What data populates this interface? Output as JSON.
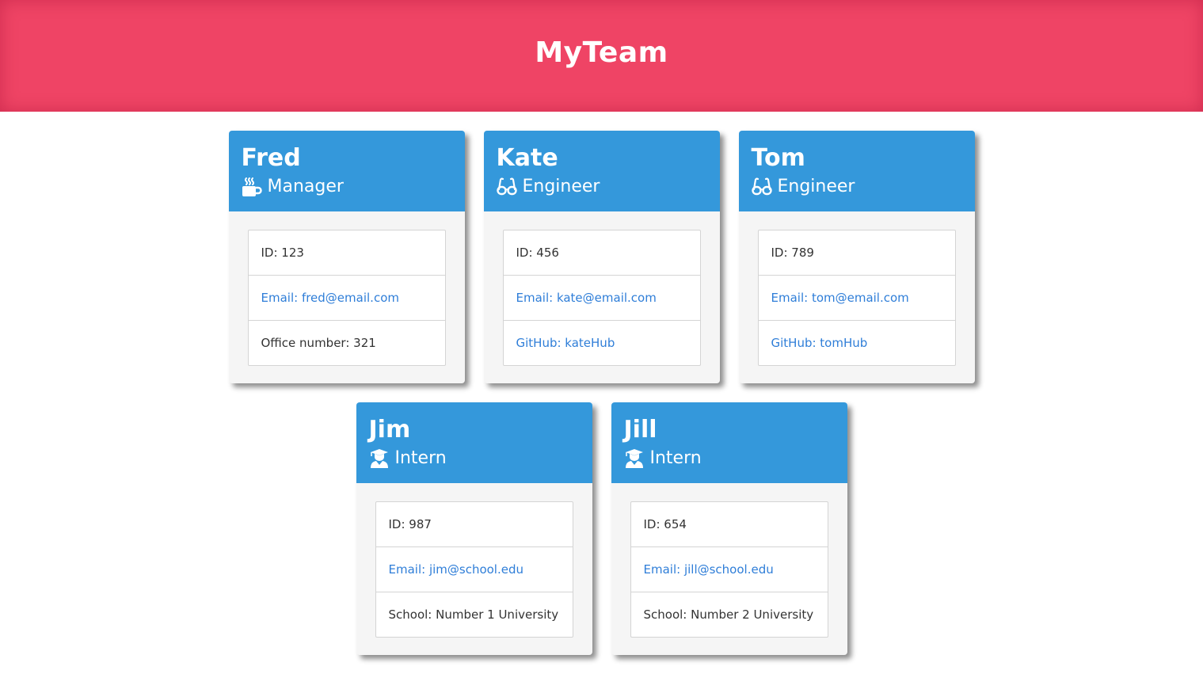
{
  "header": {
    "title": "MyTeam"
  },
  "colors": {
    "header_bg": "#ef4465",
    "card_head_bg": "#3498db",
    "link": "#2f7ed8"
  },
  "team": [
    {
      "name": "Fred",
      "role": "Manager",
      "icon": "coffee-mug-icon",
      "id_text": "ID: 123",
      "email_text": "Email: fred@email.com",
      "extra_text": "Office number: 321",
      "extra_is_link": false
    },
    {
      "name": "Kate",
      "role": "Engineer",
      "icon": "glasses-icon",
      "id_text": "ID: 456",
      "email_text": "Email: kate@email.com",
      "extra_text": "GitHub: kateHub",
      "extra_is_link": true
    },
    {
      "name": "Tom",
      "role": "Engineer",
      "icon": "glasses-icon",
      "id_text": "ID: 789",
      "email_text": "Email: tom@email.com",
      "extra_text": "GitHub: tomHub",
      "extra_is_link": true
    },
    {
      "name": "Jim",
      "role": "Intern",
      "icon": "graduate-icon",
      "id_text": "ID: 987",
      "email_text": "Email: jim@school.edu",
      "extra_text": "School: Number 1 University",
      "extra_is_link": false
    },
    {
      "name": "Jill",
      "role": "Intern",
      "icon": "graduate-icon",
      "id_text": "ID: 654",
      "email_text": "Email: jill@school.edu",
      "extra_text": "School: Number 2 University",
      "extra_is_link": false
    }
  ]
}
